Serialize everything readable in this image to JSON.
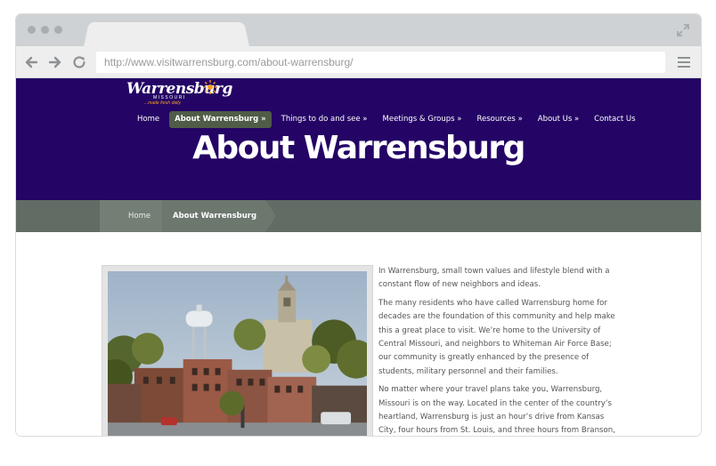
{
  "browser": {
    "url": "http://www.visitwarrensburg.com/about-warrensburg/"
  },
  "logo": {
    "main": "Warrensburg",
    "sub": "MISSOURI",
    "tagline": "...made fresh daily"
  },
  "nav": {
    "items": [
      {
        "label": "Home"
      },
      {
        "label": "About Warrensburg »"
      },
      {
        "label": "Things to do and see »"
      },
      {
        "label": "Meetings & Groups »"
      },
      {
        "label": "Resources »"
      },
      {
        "label": "About Us »"
      },
      {
        "label": "Contact Us"
      }
    ]
  },
  "page": {
    "title": "About Warrensburg"
  },
  "breadcrumb": {
    "home": "Home",
    "current": "About Warrensburg"
  },
  "content": {
    "paragraphs": [
      "In Warrensburg, small town values and lifestyle blend with a constant flow of new neighbors and ideas.",
      "The many residents who have called Warrensburg home for decades are the foundation of this community and help make this a great place to visit. We’re home to the University of Central Missouri, and neighbors to Whiteman Air Force Base; our community is greatly enhanced by the presence of students, military personnel and their families.",
      "No matter where your travel plans take you, Warrensburg, Missouri is on the way. Located in the center of the country’s heartland, Warrensburg is just an hour’s drive from Kansas City, four hours from St. Louis, and three hours from Branson, Missouri. Warrensburg residents are in the enviable position of being able to"
    ]
  },
  "colors": {
    "hero": "#240465",
    "breadcrumb_bar": "#616c64",
    "nav_active": "#4f5c47"
  }
}
